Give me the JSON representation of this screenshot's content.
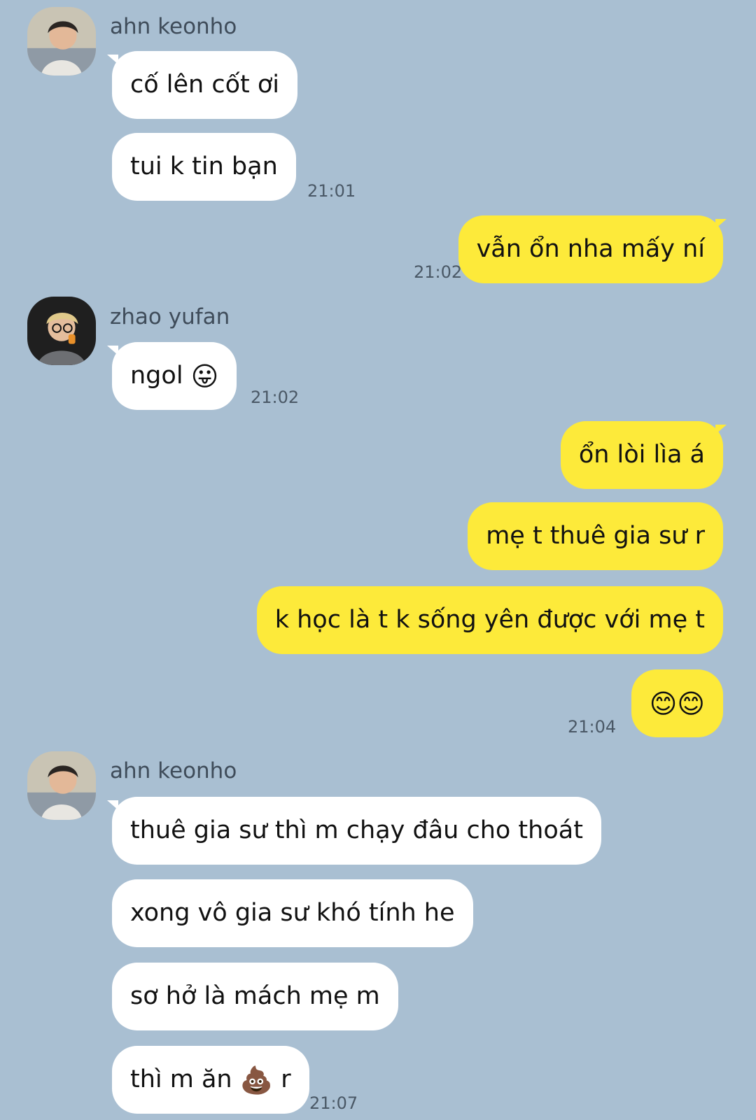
{
  "colors": {
    "background": "#a9bfd2",
    "incoming_bubble": "#ffffff",
    "outgoing_bubble": "#fdea3a"
  },
  "groups": [
    {
      "sender": "ahn keonho",
      "avatar": "avatar-ahn-keonho",
      "messages": [
        "cố lên cốt ơi",
        "tui k tin bạn"
      ],
      "time": "21:01"
    },
    {
      "outgoing": true,
      "messages": [
        "vẫn ổn nha mấy ní"
      ],
      "time": "21:02"
    },
    {
      "sender": "zhao yufan",
      "avatar": "avatar-zhao-yufan",
      "messages": [
        {
          "text": "ngol",
          "emoji": "😛"
        }
      ],
      "time": "21:02"
    },
    {
      "outgoing": true,
      "messages": [
        "ổn lòi lìa á",
        "mẹ t thuê gia sư r",
        "k học là t k sống yên được với mẹ t",
        {
          "emoji": "😊😊"
        }
      ],
      "time": "21:04"
    },
    {
      "sender": "ahn keonho",
      "avatar": "avatar-ahn-keonho",
      "messages": [
        "thuê gia sư thì m chạy đâu cho thoát",
        "xong vô gia sư khó tính he",
        "sơ hở là mách mẹ m",
        {
          "text": "thì m ăn",
          "emoji": "💩",
          "text_after": "r"
        }
      ],
      "time": "21:07"
    }
  ]
}
